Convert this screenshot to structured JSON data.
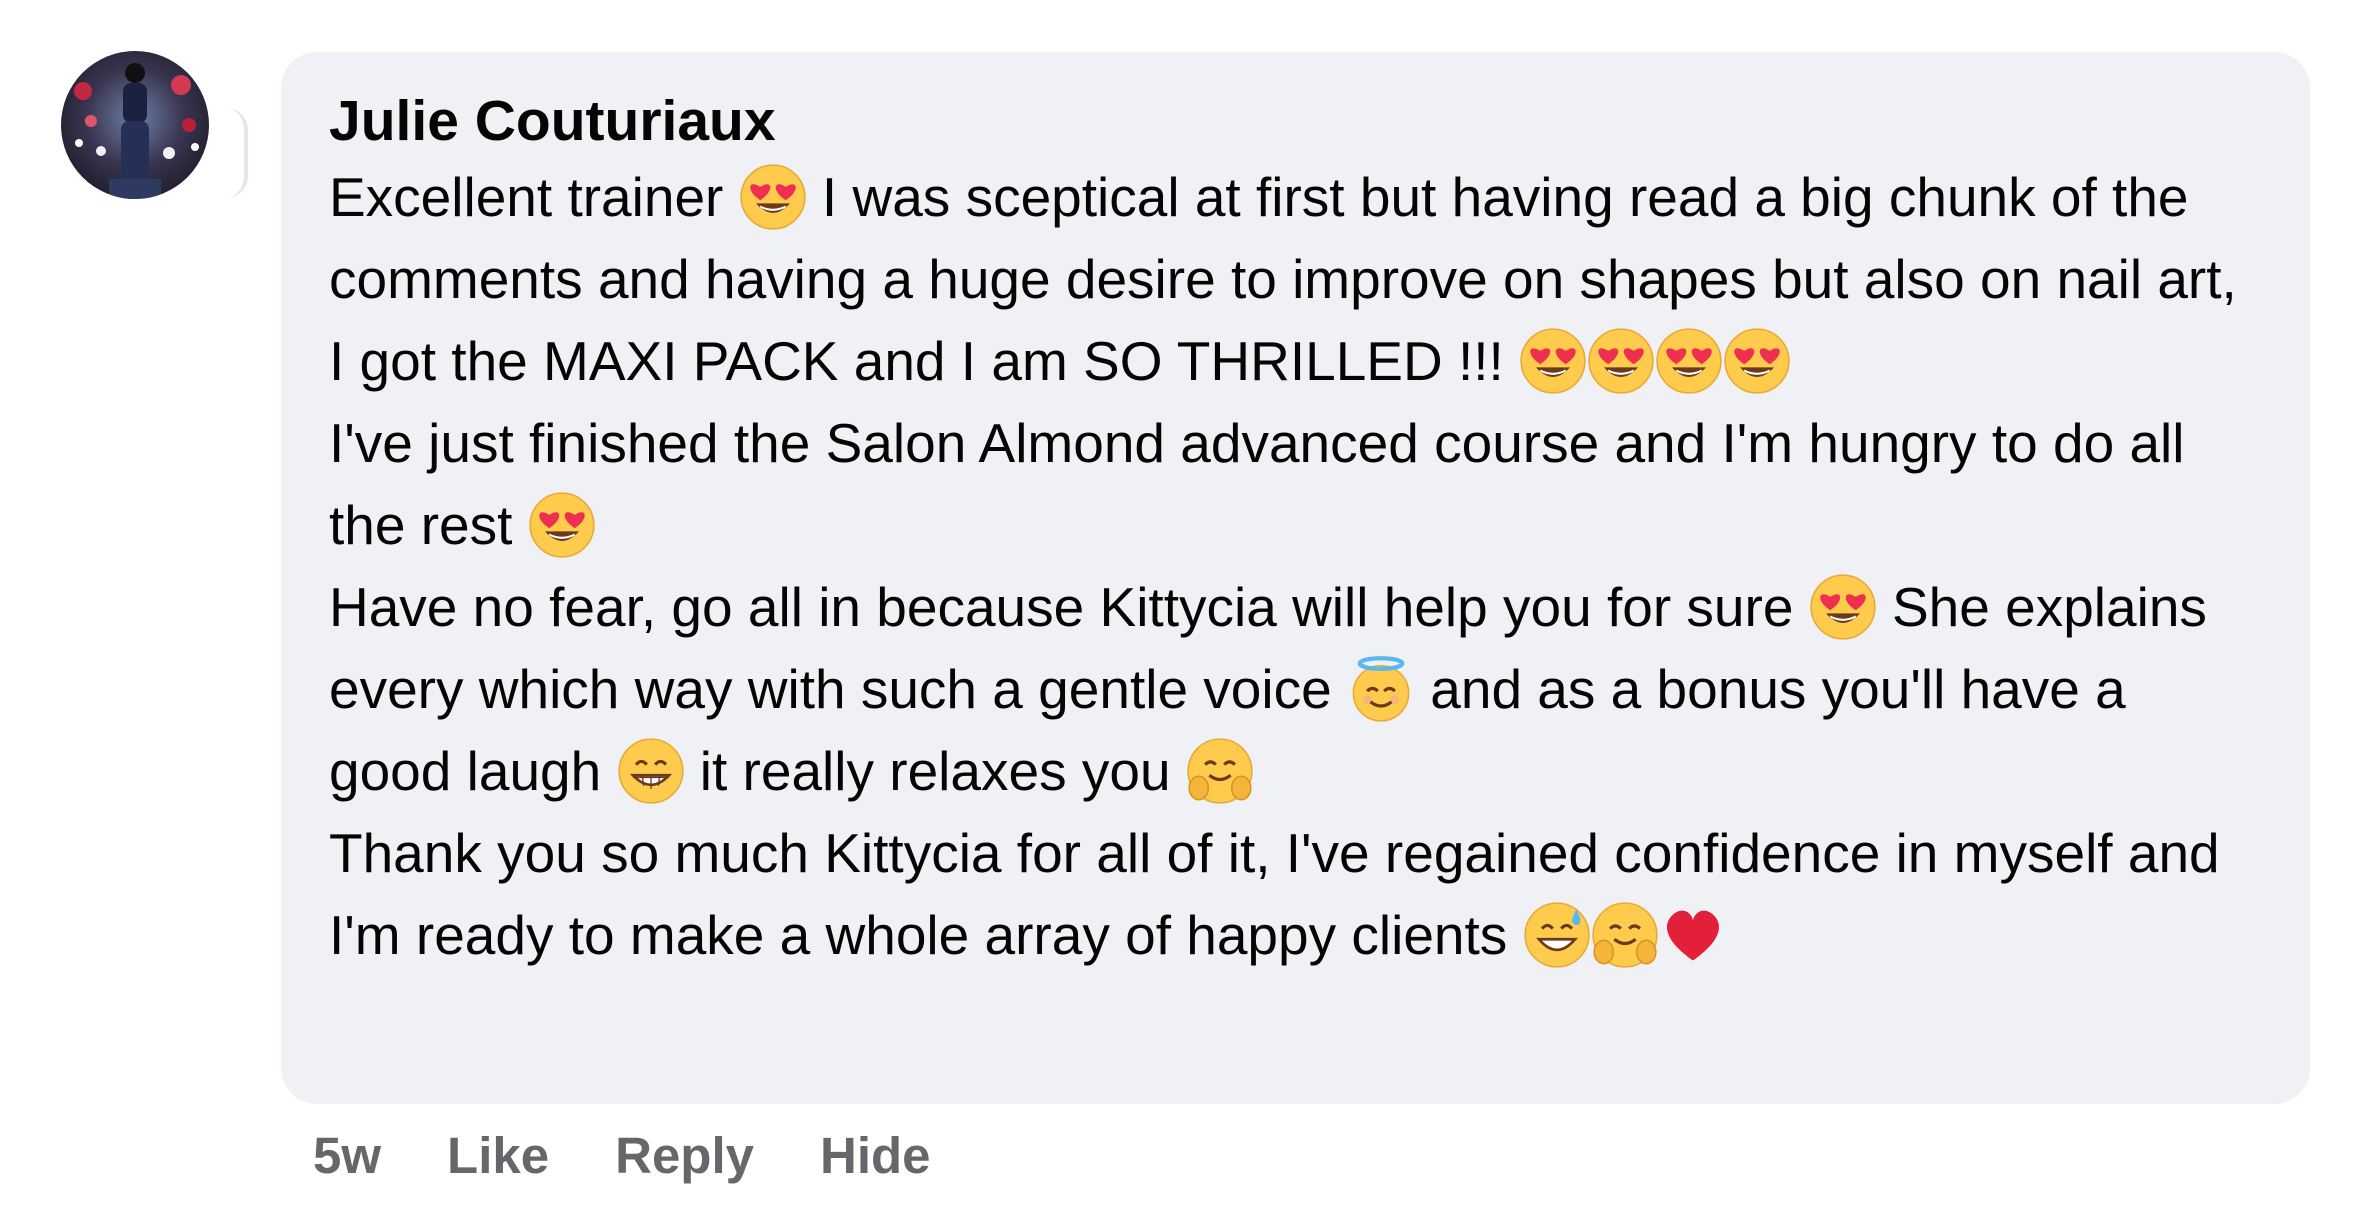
{
  "comment": {
    "author": "Julie Couturiaux",
    "paragraphs": [
      [
        {
          "t": "text",
          "v": "Excellent trainer "
        },
        {
          "t": "emoji",
          "icon": "heart-eyes-emoji"
        },
        {
          "t": "text",
          "v": " I was sceptical at first but having read a big chunk of the comments and having a huge desire to improve on shapes but also on nail art, I got the MAXI PACK and I am SO THRILLED !!! "
        },
        {
          "t": "emoji",
          "icon": "heart-eyes-emoji"
        },
        {
          "t": "emoji",
          "icon": "heart-eyes-emoji"
        },
        {
          "t": "emoji",
          "icon": "heart-eyes-emoji"
        },
        {
          "t": "emoji",
          "icon": "heart-eyes-emoji"
        }
      ],
      [
        {
          "t": "text",
          "v": "I've just finished the Salon Almond advanced course and I'm hungry to do all the rest "
        },
        {
          "t": "emoji",
          "icon": "heart-eyes-emoji"
        }
      ],
      [
        {
          "t": "text",
          "v": "Have no fear, go all in because Kittycia will help you for sure "
        },
        {
          "t": "emoji",
          "icon": "heart-eyes-emoji"
        },
        {
          "t": "text",
          "v": " She explains every which way with such a gentle voice "
        },
        {
          "t": "emoji",
          "icon": "halo-smile-emoji"
        },
        {
          "t": "text",
          "v": " and as a bonus you'll have a good laugh "
        },
        {
          "t": "emoji",
          "icon": "grin-emoji"
        },
        {
          "t": "text",
          "v": " it really relaxes you "
        },
        {
          "t": "emoji",
          "icon": "hug-emoji"
        }
      ],
      [
        {
          "t": "text",
          "v": "Thank you so much Kittycia for all of it, I've regained confidence in myself and I'm ready to make a whole array of happy clients "
        },
        {
          "t": "emoji",
          "icon": "sweat-smile-emoji"
        },
        {
          "t": "emoji",
          "icon": "hug-emoji"
        },
        {
          "t": "emoji",
          "icon": "red-heart-emoji"
        }
      ]
    ]
  },
  "actions": {
    "time": "5w",
    "like": "Like",
    "reply": "Reply",
    "hide": "Hide"
  },
  "colors": {
    "bubble": "#f0f1f5",
    "action_text": "#65676b",
    "text": "#050505"
  }
}
